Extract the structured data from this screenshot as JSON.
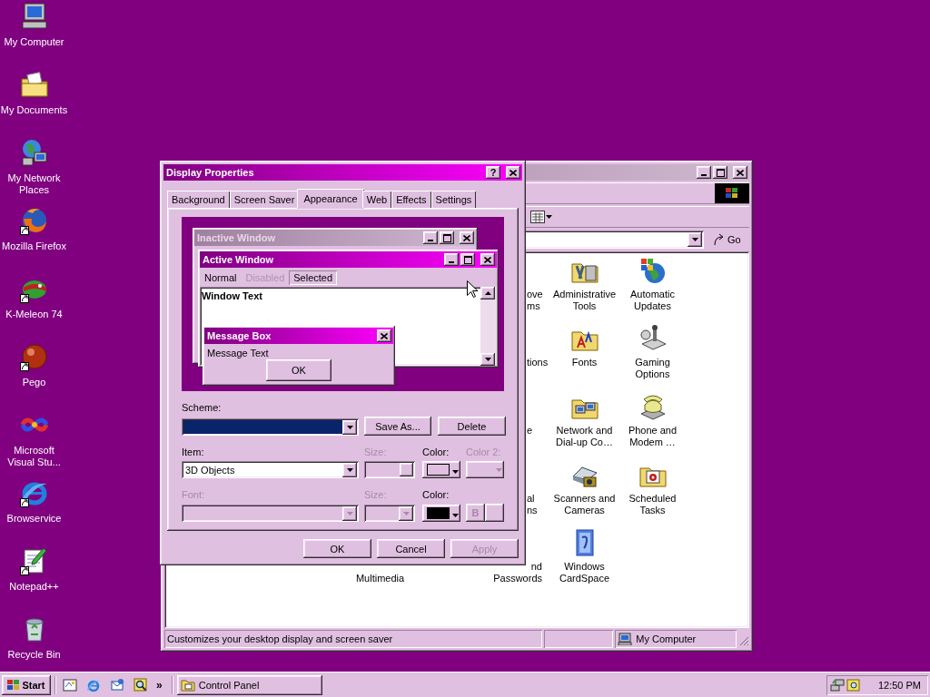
{
  "desktop_icons": [
    {
      "kind": "computer",
      "label": "My Computer",
      "shortcut": false
    },
    {
      "kind": "documents",
      "label": "My Documents",
      "shortcut": false
    },
    {
      "kind": "network",
      "label": "My Network Places",
      "shortcut": false
    },
    {
      "kind": "firefox",
      "label": "Mozilla Firefox",
      "shortcut": true
    },
    {
      "kind": "kmeleon",
      "label": "K-Meleon 74",
      "shortcut": true
    },
    {
      "kind": "pego",
      "label": "Pego",
      "shortcut": true
    },
    {
      "kind": "studio",
      "label": "Microsoft Visual Stu...",
      "shortcut": false
    },
    {
      "kind": "ie",
      "label": "Browservice",
      "shortcut": true
    },
    {
      "kind": "notepad",
      "label": "Notepad++",
      "shortcut": true
    },
    {
      "kind": "recycle",
      "label": "Recycle Bin",
      "shortcut": false
    }
  ],
  "control_panel": {
    "go_button": "Go",
    "items": [
      {
        "kind": "cut",
        "label": "ove\nms"
      },
      {
        "kind": "tools",
        "label": "Administrative Tools"
      },
      {
        "kind": "updates",
        "label": "Automatic Updates"
      },
      {
        "kind": "cut",
        "label": "tions"
      },
      {
        "kind": "fonts",
        "label": "Fonts"
      },
      {
        "kind": "gaming",
        "label": "Gaming Options"
      },
      {
        "kind": "cut",
        "label": "e"
      },
      {
        "kind": "netdial",
        "label": "Network and Dial-up Co…"
      },
      {
        "kind": "phone",
        "label": "Phone and Modem …"
      },
      {
        "kind": "cut",
        "label": "al\nns"
      },
      {
        "kind": "scanner",
        "label": "Scanners and Cameras"
      },
      {
        "kind": "tasks",
        "label": "Scheduled Tasks"
      },
      {
        "kind": "cut",
        "label": "Multimedia"
      },
      {
        "kind": "cut",
        "label": "nd\nPasswords"
      },
      {
        "kind": "card",
        "label": "Windows CardSpace"
      }
    ],
    "status_bar": {
      "text": "Customizes your desktop display and screen saver",
      "location": "My Computer"
    }
  },
  "dialog": {
    "title": "Display Properties",
    "help_button": "?",
    "tabs": [
      {
        "label": "Background",
        "selected": false
      },
      {
        "label": "Screen Saver",
        "selected": false
      },
      {
        "label": "Appearance",
        "selected": true
      },
      {
        "label": "Web",
        "selected": false
      },
      {
        "label": "Effects",
        "selected": false
      },
      {
        "label": "Settings",
        "selected": false
      }
    ],
    "preview": {
      "inactive_title": "Inactive Window",
      "active_title": "Active Window",
      "menu": [
        {
          "label": "Normal",
          "disabled": false,
          "selected": false
        },
        {
          "label": "Disabled",
          "disabled": true,
          "selected": false
        },
        {
          "label": "Selected",
          "disabled": false,
          "selected": true
        }
      ],
      "window_text": "Window Text",
      "message_title": "Message Box",
      "message_text": "Message Text",
      "message_button": "OK"
    },
    "scheme": {
      "label": "Scheme:",
      "save_button": "Save As...",
      "delete_button": "Delete"
    },
    "item": {
      "label": "Item:",
      "value": "3D Objects",
      "size_label": "Size:",
      "size_disabled": true,
      "color_label": "Color:",
      "color": "#e0c0e0",
      "color2_label": "Color 2:",
      "color2_disabled": true
    },
    "font": {
      "label": "Font:",
      "disabled": true,
      "size_label": "Size:",
      "color_label": "Color:",
      "color": "#000000",
      "bold_label": "B"
    },
    "buttons": [
      {
        "label": "OK",
        "disabled": false
      },
      {
        "label": "Cancel",
        "disabled": false
      },
      {
        "label": "Apply",
        "disabled": true
      }
    ]
  },
  "taskbar": {
    "start": "Start",
    "quick_launch": [
      {
        "kind": "desktop"
      },
      {
        "kind": "ie"
      },
      {
        "kind": "outlook"
      },
      {
        "kind": "search"
      }
    ],
    "chevron": "»",
    "tasks": [
      {
        "label": "Control Panel",
        "selected": false
      }
    ],
    "clock": "12:50 PM"
  }
}
